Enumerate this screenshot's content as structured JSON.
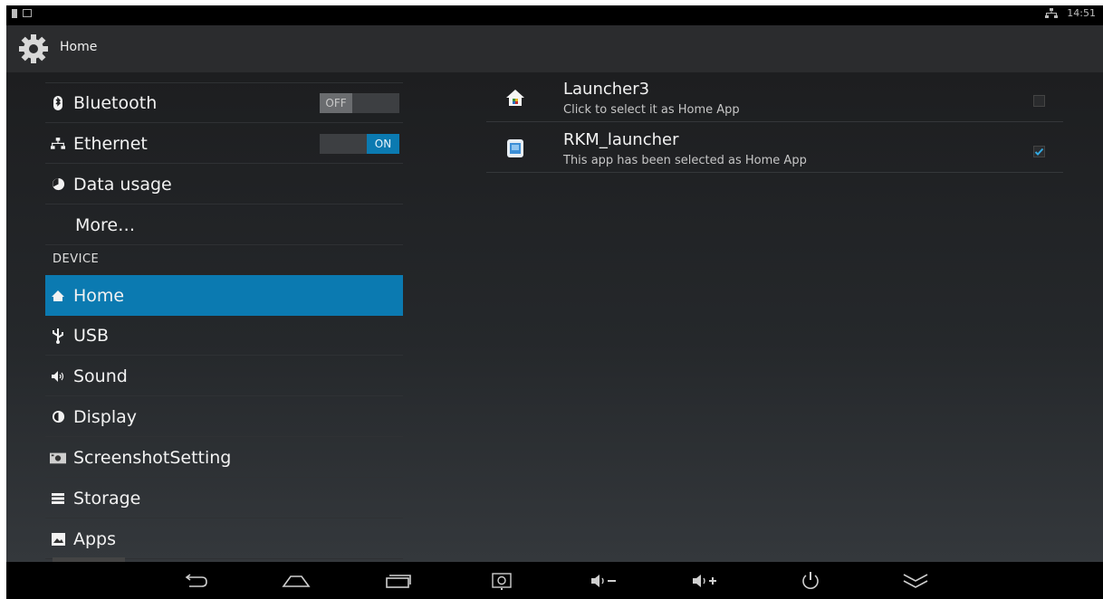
{
  "status_bar": {
    "time": "14:51",
    "icons": [
      "sd-card-icon",
      "screen-icon",
      "ethernet-icon"
    ]
  },
  "action_bar": {
    "title": "Home",
    "icon": "settings-gear-icon"
  },
  "sidebar": {
    "items": [
      {
        "label": "Bluetooth",
        "icon": "bluetooth-icon",
        "toggle": "OFF"
      },
      {
        "label": "Ethernet",
        "icon": "ethernet-icon",
        "toggle": "ON"
      },
      {
        "label": "Data usage",
        "icon": "data-usage-icon"
      },
      {
        "label": "More…"
      },
      {
        "label": "Home",
        "icon": "home-icon",
        "selected": true
      },
      {
        "label": "USB",
        "icon": "usb-icon"
      },
      {
        "label": "Sound",
        "icon": "sound-icon"
      },
      {
        "label": "Display",
        "icon": "display-icon"
      },
      {
        "label": "ScreenshotSetting",
        "icon": "camera-icon"
      },
      {
        "label": "Storage",
        "icon": "storage-icon"
      },
      {
        "label": "Apps",
        "icon": "apps-icon"
      }
    ],
    "section_device": "DEVICE"
  },
  "home_apps": [
    {
      "name": "Launcher3",
      "subtitle": "Click to select it as Home App",
      "checked": false,
      "icon": "launcher3-icon"
    },
    {
      "name": "RKM_launcher",
      "subtitle": "This app has been selected as Home App",
      "checked": true,
      "icon": "rkm-launcher-icon"
    }
  ],
  "navbar": {
    "buttons": [
      "back-icon",
      "home-icon",
      "recents-icon",
      "screenshot-icon",
      "volume-down-icon",
      "volume-up-icon",
      "power-icon",
      "collapse-icon"
    ]
  },
  "colors": {
    "accent": "#0b7ab1",
    "background": "#1f2022",
    "action_bar": "#2b2c2e"
  }
}
